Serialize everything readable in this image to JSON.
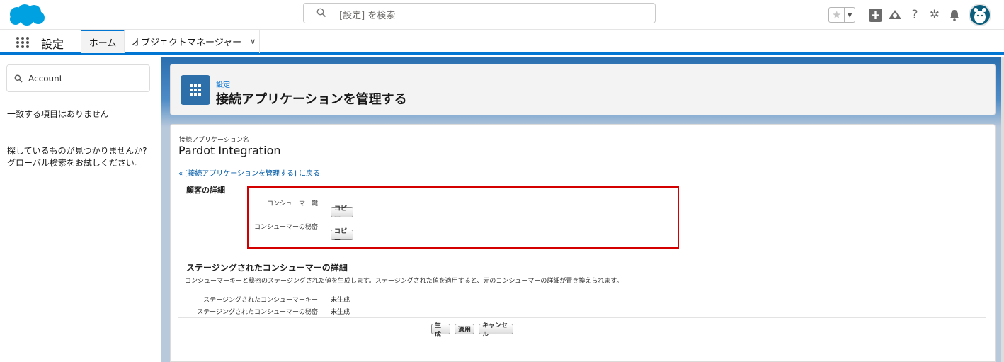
{
  "header": {
    "search_placeholder": "[設定] を検索"
  },
  "app_nav": {
    "app_name": "設定",
    "tabs": [
      {
        "label": "ホーム"
      },
      {
        "label": "オブジェクトマネージャー"
      }
    ]
  },
  "sidebar": {
    "search_value": "Account",
    "no_match": "一致する項目はありません",
    "help_line1": "探しているものが見つかりませんか?",
    "help_line2": "グローバル検索をお試しください。"
  },
  "page_header": {
    "breadcrumb": "設定",
    "title": "接続アプリケーションを管理する"
  },
  "content": {
    "name_label": "接続アプリケーション名",
    "app_name": "Pardot Integration",
    "back_link": "« [接続アプリケーションを管理する] に戻る",
    "customer_section": {
      "title": "顧客の詳細",
      "fields": [
        {
          "label": "コンシューマー鍵",
          "button": "コピー"
        },
        {
          "label": "コンシューマーの秘密",
          "button": "コピー"
        }
      ]
    },
    "staging_section": {
      "title": "ステージングされたコンシューマーの詳細",
      "description": "コンシューマーキーと秘密のステージングされた値を生成します。ステージングされた値を適用すると、元のコンシューマーの詳細が置き換えられます。",
      "fields": [
        {
          "label": "ステージングされたコンシューマーキー",
          "value": "未生成"
        },
        {
          "label": "ステージングされたコンシューマーの秘密",
          "value": "未生成"
        }
      ],
      "buttons": {
        "generate": "生成",
        "apply": "適用",
        "cancel": "キャンセル"
      }
    }
  },
  "colors": {
    "brand": "#00a1e0",
    "accent": "#0176d3",
    "highlight_box": "#d40000"
  }
}
